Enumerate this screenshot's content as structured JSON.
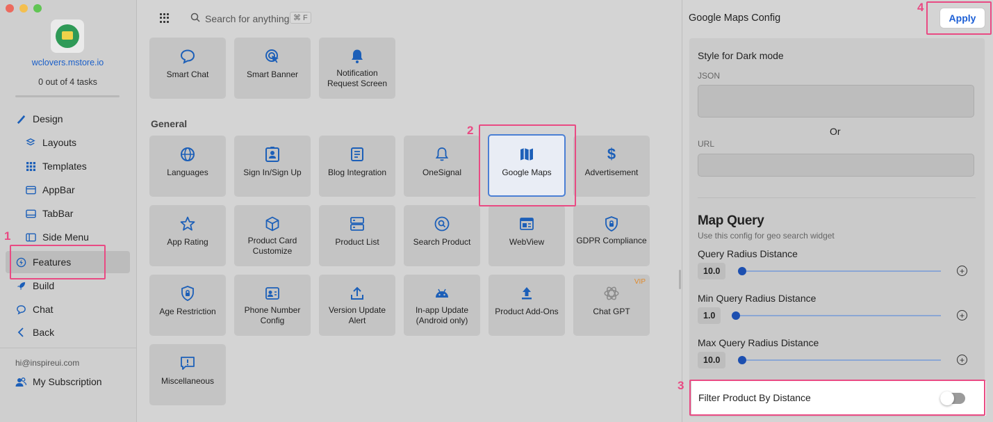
{
  "sidebar": {
    "store_name": "wclovers.mstore.io",
    "tasks": "0 out of 4 tasks",
    "items": [
      {
        "label": "Design",
        "icon": "brush-icon"
      },
      {
        "label": "Layouts",
        "icon": "layers-icon"
      },
      {
        "label": "Templates",
        "icon": "grid-dots-icon"
      },
      {
        "label": "AppBar",
        "icon": "appbar-icon"
      },
      {
        "label": "TabBar",
        "icon": "tabbar-icon"
      },
      {
        "label": "Side Menu",
        "icon": "side-menu-icon"
      },
      {
        "label": "Features",
        "icon": "bolt-icon"
      },
      {
        "label": "Build",
        "icon": "rocket-icon"
      },
      {
        "label": "Chat",
        "icon": "chat-icon"
      },
      {
        "label": "Back",
        "icon": "chevron-left-icon"
      }
    ],
    "email": "hi@inspireui.com",
    "subscription": "My Subscription"
  },
  "search": {
    "placeholder": "Search for anything",
    "shortcut": "⌘ F"
  },
  "top_cards": [
    {
      "label": "Smart Chat",
      "icon": "chat-bubble-icon"
    },
    {
      "label": "Smart Banner",
      "icon": "target-cursor-icon"
    },
    {
      "label": "Notification Request Screen",
      "icon": "bell-icon"
    }
  ],
  "general": {
    "title": "General",
    "cards": [
      {
        "label": "Languages",
        "icon": "globe-icon"
      },
      {
        "label": "Sign In/Sign Up",
        "icon": "id-card-icon"
      },
      {
        "label": "Blog Integration",
        "icon": "document-icon"
      },
      {
        "label": "OneSignal",
        "icon": "bell-outline-icon"
      },
      {
        "label": "Google Maps",
        "icon": "map-icon"
      },
      {
        "label": "Advertisement",
        "icon": "dollar-icon"
      },
      {
        "label": "App Rating",
        "icon": "star-icon"
      },
      {
        "label": "Product Card Customize",
        "icon": "cube-icon"
      },
      {
        "label": "Product List",
        "icon": "list-icon"
      },
      {
        "label": "Search Product",
        "icon": "search-circle-icon"
      },
      {
        "label": "WebView",
        "icon": "browser-icon"
      },
      {
        "label": "GDPR Compliance",
        "icon": "shield-lock-icon"
      },
      {
        "label": "Age Restriction",
        "icon": "shield-lock-icon"
      },
      {
        "label": "Phone Number Config",
        "icon": "contact-card-icon"
      },
      {
        "label": "Version Update Alert",
        "icon": "upload-icon"
      },
      {
        "label": "In-app Update (Android only)",
        "icon": "android-icon"
      },
      {
        "label": "Product Add-Ons",
        "icon": "upload-arrow-icon"
      },
      {
        "label": "Chat GPT",
        "icon": "openai-icon",
        "badge": "VIP"
      },
      {
        "label": "Miscellaneous",
        "icon": "alert-bubble-icon"
      }
    ]
  },
  "panel": {
    "title": "Google Maps Config",
    "apply": "Apply",
    "dark_mode_title": "Style for Dark mode",
    "json_label": "JSON",
    "or": "Or",
    "url_label": "URL",
    "map_query_title": "Map Query",
    "map_query_desc": "Use this config for geo search widget",
    "sliders": [
      {
        "label": "Query Radius Distance",
        "value": "10.0",
        "fraction": 0.0
      },
      {
        "label": "Min Query Radius Distance",
        "value": "1.0",
        "fraction": 0.0
      },
      {
        "label": "Max Query Radius Distance",
        "value": "10.0",
        "fraction": 0.0
      }
    ],
    "filter_label": "Filter Product By Distance",
    "filter_on": false
  },
  "annotations": {
    "n1": "1",
    "n2": "2",
    "n3": "3",
    "n4": "4",
    "color": "#e94a83"
  }
}
